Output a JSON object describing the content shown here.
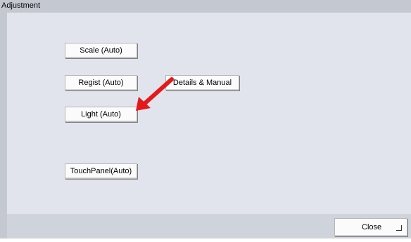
{
  "window": {
    "title": "Adjustment"
  },
  "buttons": {
    "scale": "Scale (Auto)",
    "regist": "Regist (Auto)",
    "details": "Details & Manual",
    "light": "Light (Auto)",
    "touchpanel": "TouchPanel(Auto)",
    "close": "Close"
  },
  "annotation": {
    "arrow_color": "#e41a1a",
    "icon": "red-arrow-icon"
  }
}
